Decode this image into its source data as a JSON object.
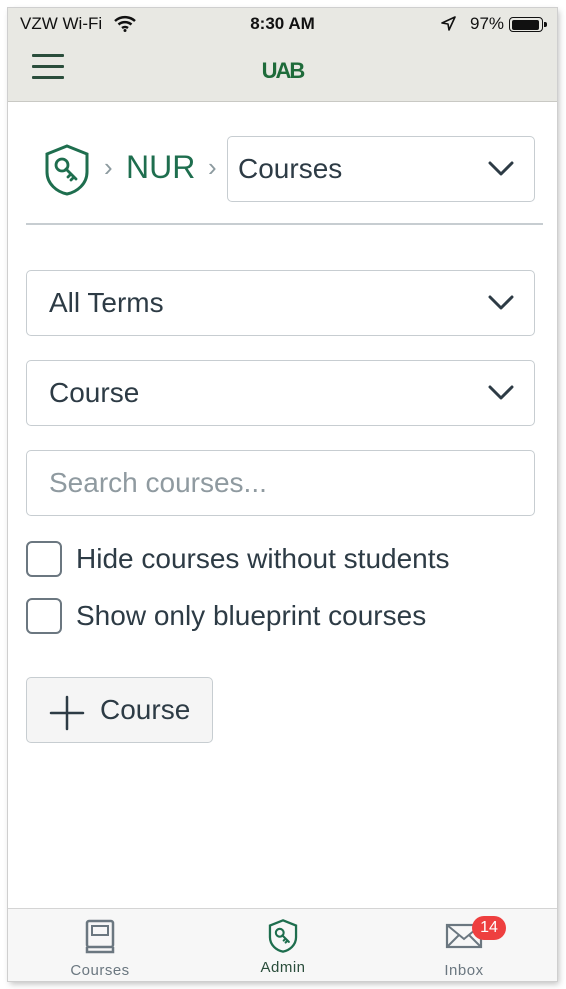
{
  "status_bar": {
    "carrier": "VZW Wi-Fi",
    "time": "8:30 AM",
    "battery_text": "97%",
    "battery_level": 0.97
  },
  "header": {
    "logo_text": "UAB"
  },
  "breadcrumb": {
    "separator": "›",
    "account": "NUR",
    "section_select": "Courses"
  },
  "filters": {
    "term_select": "All Terms",
    "type_select": "Course",
    "search_placeholder": "Search courses...",
    "hide_without_students_label": "Hide courses without students",
    "blueprint_only_label": "Show only blueprint courses"
  },
  "add_course_button": {
    "label": "Course"
  },
  "tabbar": {
    "courses_label": "Courses",
    "admin_label": "Admin",
    "inbox_label": "Inbox",
    "inbox_badge": "14"
  },
  "colors": {
    "brand_green": "#1e6e4e",
    "header_bg": "#e8e8e3",
    "badge_red": "#ee3f3f"
  }
}
